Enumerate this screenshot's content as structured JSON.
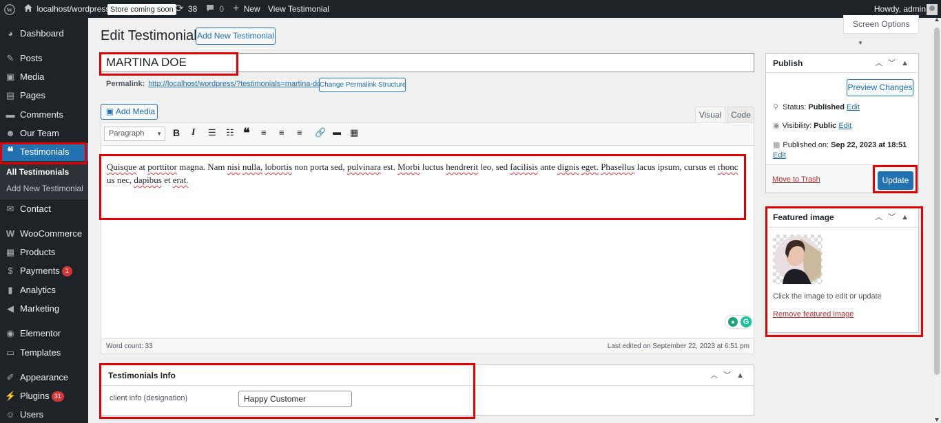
{
  "admin_bar": {
    "site_name": "localhost/wordpress",
    "store_badge": "Store coming soon",
    "updates_count": "38",
    "comments_count": "0",
    "new_label": "New",
    "view_label": "View Testimonial",
    "howdy": "Howdy, admin"
  },
  "sidebar": {
    "items": [
      {
        "label": "Dashboard",
        "icon": "dashboard-icon"
      },
      {
        "label": "Posts",
        "icon": "pin-icon"
      },
      {
        "label": "Media",
        "icon": "media-icon"
      },
      {
        "label": "Pages",
        "icon": "pages-icon"
      },
      {
        "label": "Comments",
        "icon": "comment-icon"
      },
      {
        "label": "Our Team",
        "icon": "team-icon"
      },
      {
        "label": "Testimonials",
        "icon": "quote-icon"
      },
      {
        "label": "Contact",
        "icon": "mail-icon"
      },
      {
        "label": "WooCommerce",
        "icon": "woo-icon"
      },
      {
        "label": "Products",
        "icon": "archive-icon"
      },
      {
        "label": "Payments",
        "icon": "payments-icon",
        "badge": "1"
      },
      {
        "label": "Analytics",
        "icon": "chart-icon"
      },
      {
        "label": "Marketing",
        "icon": "megaphone-icon"
      },
      {
        "label": "Elementor",
        "icon": "elementor-icon"
      },
      {
        "label": "Templates",
        "icon": "folder-icon"
      },
      {
        "label": "Appearance",
        "icon": "brush-icon"
      },
      {
        "label": "Plugins",
        "icon": "plugin-icon",
        "badge": "31"
      },
      {
        "label": "Users",
        "icon": "user-icon"
      }
    ],
    "submenu": {
      "all": "All Testimonials",
      "add_new": "Add New Testimonial"
    }
  },
  "screen_options": "Screen Options",
  "page_title": "Edit Testimonial",
  "add_new_button": "Add New Testimonial",
  "post_title": "MARTINA DOE",
  "permalink": {
    "label": "Permalink:",
    "url": "http://localhost/wordpress/?testimonials=martina-doe",
    "change_button": "Change Permalink Structure"
  },
  "editor": {
    "add_media": "Add Media",
    "tab_visual": "Visual",
    "tab_code": "Code",
    "format_select": "Paragraph",
    "content_words": [
      {
        "w": "Quisque",
        "s": true
      },
      {
        "w": "at",
        "s": false
      },
      {
        "w": "porttitor",
        "s": true
      },
      {
        "w": "magna.",
        "s": false
      },
      {
        "w": "Nam",
        "s": false
      },
      {
        "w": "nisi",
        "s": true
      },
      {
        "w": "nulla,",
        "s": true
      },
      {
        "w": "lobortis",
        "s": true
      },
      {
        "w": "non",
        "s": false
      },
      {
        "w": "porta",
        "s": false
      },
      {
        "w": "sed,",
        "s": false
      },
      {
        "w": "pulvinara",
        "s": true
      },
      {
        "w": "est.",
        "s": false
      },
      {
        "w": "Morbi",
        "s": true
      },
      {
        "w": "luctus",
        "s": false
      },
      {
        "w": "hendrerit",
        "s": true
      },
      {
        "w": "leo,",
        "s": false
      },
      {
        "w": "sed",
        "s": false
      },
      {
        "w": "facilisis",
        "s": true
      },
      {
        "w": "ante",
        "s": false
      },
      {
        "w": "dignis",
        "s": true
      },
      {
        "w": "eget.",
        "s": true
      },
      {
        "w": "Phasellus",
        "s": true
      },
      {
        "w": "lacus",
        "s": false
      },
      {
        "w": "ipsum,",
        "s": false
      },
      {
        "w": "cursus",
        "s": false
      },
      {
        "w": "et",
        "s": false
      },
      {
        "w": "rhonc",
        "s": true
      },
      {
        "w": "us",
        "s": false
      },
      {
        "w": "nec,",
        "s": false
      },
      {
        "w": "dapibus",
        "s": true
      },
      {
        "w": "et",
        "s": false
      },
      {
        "w": "erat.",
        "s": true
      }
    ],
    "word_count": "Word count: 33",
    "last_edited": "Last edited on September 22, 2023 at 6:51 pm"
  },
  "info_box": {
    "title": "Testimonials Info",
    "field_label": "client info (designation)",
    "field_value": "Happy Customer"
  },
  "publish": {
    "title": "Publish",
    "preview": "Preview Changes",
    "status_label": "Status:",
    "status_value": "Published",
    "visibility_label": "Visibility:",
    "visibility_value": "Public",
    "published_label": "Published on:",
    "published_value": "Sep 22, 2023 at 18:51",
    "edit": "Edit",
    "trash": "Move to Trash",
    "update": "Update"
  },
  "featured": {
    "title": "Featured image",
    "hint": "Click the image to edit or update",
    "remove": "Remove featured image"
  },
  "colors": {
    "accent": "#2271b1",
    "highlight": "#e00000",
    "sidebar": "#1d2327"
  }
}
